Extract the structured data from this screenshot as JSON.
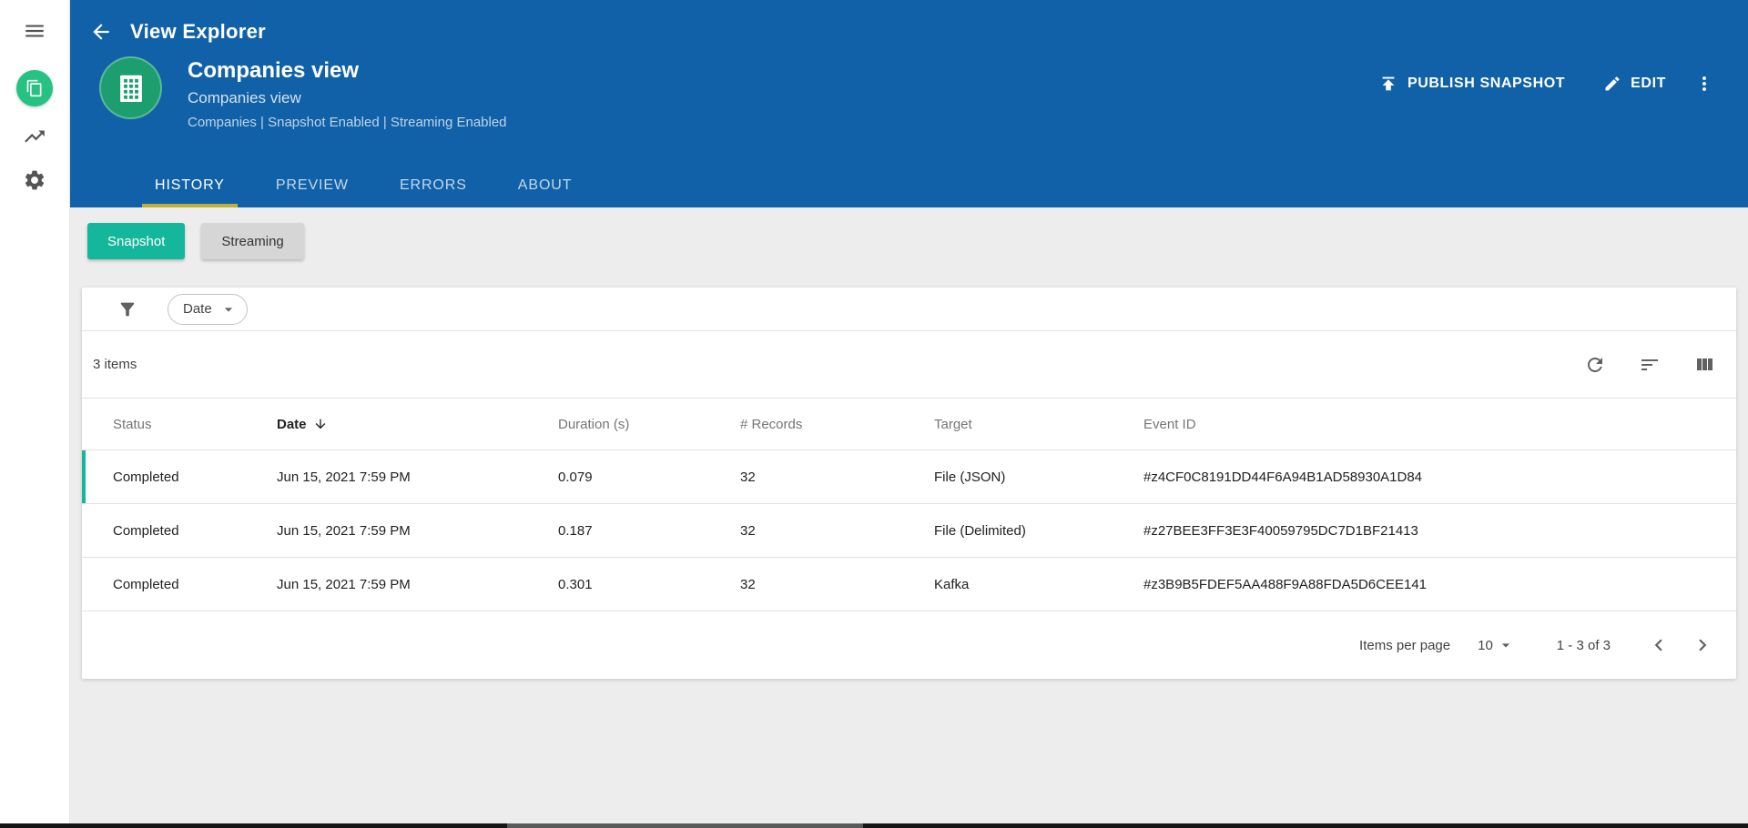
{
  "colors": {
    "header_blue": "#1161A8",
    "accent_teal": "#14B79B",
    "tab_underline": "#BFAE3A",
    "avatar_green": "#1D9E6E",
    "sidebar_badge_green": "#26C281"
  },
  "icons": {
    "menu": "hamburger",
    "collections": "overlapping-pages",
    "trending": "line-chart",
    "settings": "gear",
    "back": "arrow-left",
    "building": "building-windows",
    "publish": "upload-arrow",
    "edit": "pencil",
    "more": "kebab-vertical-dots",
    "filter": "funnel",
    "caret": "▾",
    "refresh": "circular-arrow",
    "sort": "descending-lines",
    "columns": "vertical-bars",
    "sort_desc": "↓",
    "chevron_left": "‹",
    "chevron_right": "›"
  },
  "header": {
    "app_title": "View Explorer",
    "view": {
      "title": "Companies view",
      "subtitle": "Companies view",
      "meta": "Companies | Snapshot Enabled | Streaming Enabled"
    },
    "actions": {
      "publish_label": "PUBLISH SNAPSHOT",
      "edit_label": "EDIT"
    },
    "tabs": [
      {
        "label": "HISTORY",
        "active": true
      },
      {
        "label": "PREVIEW",
        "active": false
      },
      {
        "label": "ERRORS",
        "active": false
      },
      {
        "label": "ABOUT",
        "active": false
      }
    ]
  },
  "toggles": {
    "snapshot_label": "Snapshot",
    "streaming_label": "Streaming"
  },
  "filter_bar": {
    "chip_label": "Date"
  },
  "table": {
    "items_count": "3 items",
    "columns": [
      "Status",
      "Date",
      "Duration (s)",
      "# Records",
      "Target",
      "Event ID"
    ],
    "sort": {
      "column": "Date",
      "direction": "desc"
    },
    "rows": [
      {
        "status": "Completed",
        "date": "Jun 15, 2021 7:59 PM",
        "duration": "0.079",
        "records": "32",
        "target": "File (JSON)",
        "event_id": "#z4CF0C8191DD44F6A94B1AD58930A1D84"
      },
      {
        "status": "Completed",
        "date": "Jun 15, 2021 7:59 PM",
        "duration": "0.187",
        "records": "32",
        "target": "File (Delimited)",
        "event_id": "#z27BEE3FF3E3F40059795DC7D1BF21413"
      },
      {
        "status": "Completed",
        "date": "Jun 15, 2021 7:59 PM",
        "duration": "0.301",
        "records": "32",
        "target": "Kafka",
        "event_id": "#z3B9B5FDEF5AA488F9A88FDA5D6CEE141"
      }
    ]
  },
  "pagination": {
    "items_per_page_label": "Items per page",
    "page_size": "10",
    "range_label": "1 - 3 of 3"
  }
}
